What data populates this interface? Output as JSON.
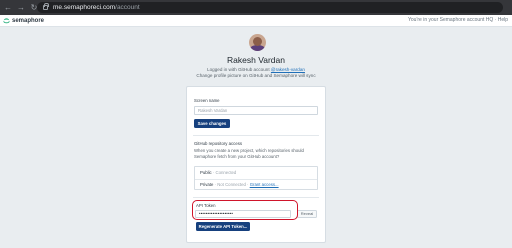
{
  "browser": {
    "url_host": "me.semaphoreci.com",
    "url_path": "/account"
  },
  "header": {
    "logo_text": "semaphore",
    "right_text": "You're in your Semaphore account HQ · Help"
  },
  "profile": {
    "name": "Rakesh Vardan",
    "logged_prefix": "Logged in with GitHub account ",
    "github_handle": "@rakesh-vardan",
    "change_text": "Change profile picture on GitHub and Semaphore will sync"
  },
  "screen_name": {
    "label": "Screen name",
    "value": "Rakesh Vardan",
    "save_button": "Save changes"
  },
  "github_access": {
    "label": "GitHub repository access",
    "description_1": "When you create a new project, which repositories should",
    "description_2": "Semaphore fetch from your GitHub account?",
    "public_label": "Public",
    "public_status": " · Connected",
    "private_label": "Private",
    "private_status": " · Not Connected · ",
    "private_link": "Grant access..."
  },
  "api_token": {
    "label": "API Token",
    "value": "••••••••••••••••••••",
    "reveal_button": "Reveal",
    "regenerate_button": "Regenerate API Token..."
  }
}
